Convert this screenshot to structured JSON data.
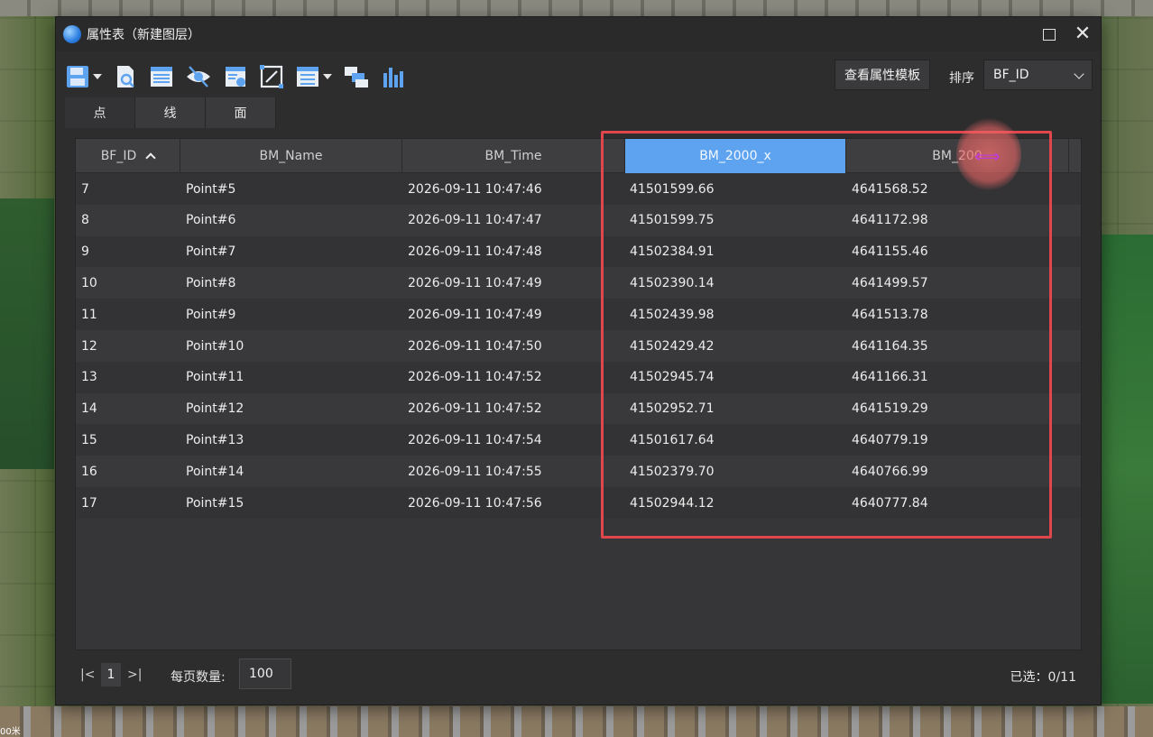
{
  "window": {
    "title": "属性表（新建图层）"
  },
  "toolbar": {
    "buttons": [
      {
        "name": "save-icon",
        "has_dropdown": true
      },
      {
        "name": "query-icon",
        "has_dropdown": false
      },
      {
        "name": "table-icon",
        "has_dropdown": false
      },
      {
        "name": "hide-icon",
        "has_dropdown": false
      },
      {
        "name": "field-calc-icon",
        "has_dropdown": false
      },
      {
        "name": "zoom-to-icon",
        "has_dropdown": false
      },
      {
        "name": "list-icon",
        "has_dropdown": true
      },
      {
        "name": "layers-icon",
        "has_dropdown": false
      },
      {
        "name": "chart-icon",
        "has_dropdown": false
      }
    ],
    "view_template_label": "查看属性模板",
    "sort_label": "排序",
    "sort_value": "BF_ID"
  },
  "tabs": [
    "点",
    "线",
    "面"
  ],
  "table": {
    "columns": [
      "BF_ID",
      "BM_Name",
      "BM_Time",
      "BM_2000_x",
      "BM_200"
    ],
    "selected_column": "BM_2000_x",
    "sort_column": "BF_ID",
    "sort_direction": "ascending",
    "rows": [
      {
        "bf_id": "7",
        "name": "Point#5",
        "time": "2026-09-11 10:47:46",
        "x": "41501599.66",
        "y": "4641568.52"
      },
      {
        "bf_id": "8",
        "name": "Point#6",
        "time": "2026-09-11 10:47:47",
        "x": "41501599.75",
        "y": "4641172.98"
      },
      {
        "bf_id": "9",
        "name": "Point#7",
        "time": "2026-09-11 10:47:48",
        "x": "41502384.91",
        "y": "4641155.46"
      },
      {
        "bf_id": "10",
        "name": "Point#8",
        "time": "2026-09-11 10:47:49",
        "x": "41502390.14",
        "y": "4641499.57"
      },
      {
        "bf_id": "11",
        "name": "Point#9",
        "time": "2026-09-11 10:47:49",
        "x": "41502439.98",
        "y": "4641513.78"
      },
      {
        "bf_id": "12",
        "name": "Point#10",
        "time": "2026-09-11 10:47:50",
        "x": "41502429.42",
        "y": "4641164.35"
      },
      {
        "bf_id": "13",
        "name": "Point#11",
        "time": "2026-09-11 10:47:52",
        "x": "41502945.74",
        "y": "4641166.31"
      },
      {
        "bf_id": "14",
        "name": "Point#12",
        "time": "2026-09-11 10:47:52",
        "x": "41502952.71",
        "y": "4641519.29"
      },
      {
        "bf_id": "15",
        "name": "Point#13",
        "time": "2026-09-11 10:47:54",
        "x": "41501617.64",
        "y": "4640779.19"
      },
      {
        "bf_id": "16",
        "name": "Point#14",
        "time": "2026-09-11 10:47:55",
        "x": "41502379.70",
        "y": "4640766.99"
      },
      {
        "bf_id": "17",
        "name": "Point#15",
        "time": "2026-09-11 10:47:56",
        "x": "41502944.12",
        "y": "4640777.84"
      }
    ]
  },
  "footer": {
    "first_page_glyph": "|<",
    "current_page": "1",
    "last_page_glyph": ">|",
    "per_page_label": "每页数量:",
    "per_page_value": "100",
    "selected_count": "已选：0/11"
  },
  "background": {
    "corner_text": "00米"
  },
  "colors": {
    "accent": "#5ea3f0",
    "highlight": "#e0474d",
    "window_bg": "#2d2d2e"
  }
}
